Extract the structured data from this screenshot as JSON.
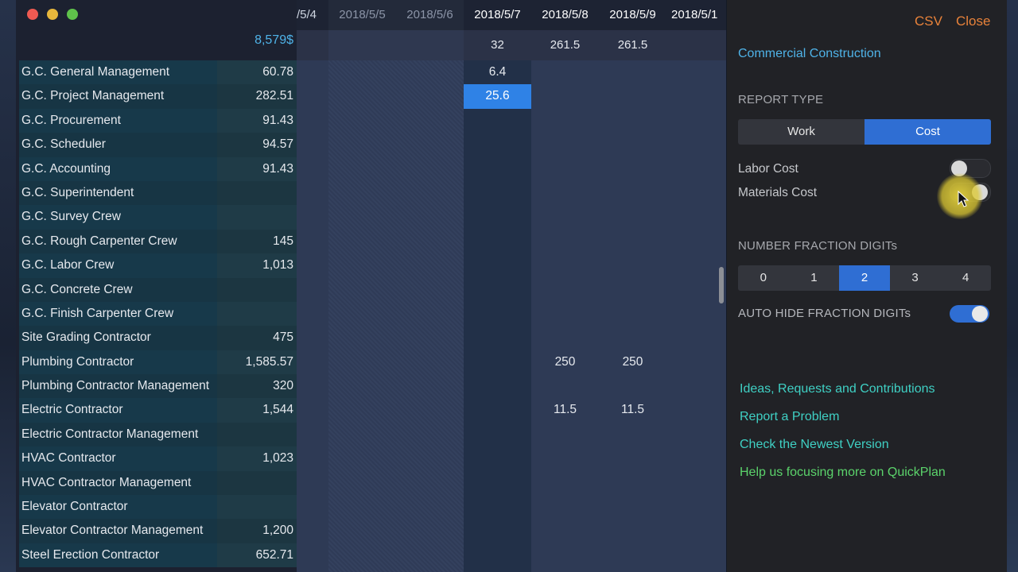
{
  "window": {
    "total": "8,579$"
  },
  "dates": [
    {
      "label": "/5/4",
      "kind": "weekday",
      "sum": "",
      "values": {}
    },
    {
      "label": "2018/5/5",
      "kind": "weekend",
      "sum": "",
      "values": {}
    },
    {
      "label": "2018/5/6",
      "kind": "weekend",
      "sum": "",
      "values": {}
    },
    {
      "label": "2018/5/7",
      "kind": "today",
      "sum": "32",
      "values": {
        "0": "6.4",
        "1": "25.6"
      }
    },
    {
      "label": "2018/5/8",
      "kind": "weekday",
      "sum": "261.5",
      "values": {
        "12": "250",
        "14": "11.5"
      }
    },
    {
      "label": "2018/5/9",
      "kind": "weekday",
      "sum": "261.5",
      "values": {
        "12": "250",
        "14": "11.5"
      }
    },
    {
      "label": "2018/5/1",
      "kind": "weekday",
      "sum": "",
      "values": {}
    }
  ],
  "rows": [
    {
      "name": "G.C. General Management",
      "total": "60.78"
    },
    {
      "name": "G.C. Project Management",
      "total": "282.51"
    },
    {
      "name": "G.C. Procurement",
      "total": "91.43"
    },
    {
      "name": "G.C. Scheduler",
      "total": "94.57"
    },
    {
      "name": "G.C. Accounting",
      "total": "91.43"
    },
    {
      "name": "G.C. Superintendent",
      "total": ""
    },
    {
      "name": "G.C. Survey Crew",
      "total": ""
    },
    {
      "name": "G.C. Rough Carpenter Crew",
      "total": "145"
    },
    {
      "name": "G.C. Labor Crew",
      "total": "1,013"
    },
    {
      "name": "G.C. Concrete Crew",
      "total": ""
    },
    {
      "name": "G.C. Finish Carpenter Crew",
      "total": ""
    },
    {
      "name": "Site Grading Contractor",
      "total": "475"
    },
    {
      "name": "Plumbing Contractor",
      "total": "1,585.57"
    },
    {
      "name": "Plumbing Contractor Management",
      "total": "320"
    },
    {
      "name": "Electric Contractor",
      "total": "1,544"
    },
    {
      "name": "Electric Contractor Management",
      "total": ""
    },
    {
      "name": "HVAC Contractor",
      "total": "1,023"
    },
    {
      "name": "HVAC Contractor Management",
      "total": ""
    },
    {
      "name": "Elevator Contractor",
      "total": ""
    },
    {
      "name": "Elevator Contractor Management",
      "total": "1,200"
    },
    {
      "name": "Steel Erection Contractor",
      "total": "652.71"
    }
  ],
  "panel": {
    "csv_label": "CSV",
    "close_label": "Close",
    "project_title": "Commercial Construction",
    "report_type_label": "REPORT TYPE",
    "report_type_options": [
      "Work",
      "Cost"
    ],
    "report_type_selected": "Cost",
    "labor_cost_label": "Labor Cost",
    "materials_cost_label": "Materials Cost",
    "fraction_label": "NUMBER FRACTION DIGITs",
    "fraction_options": [
      "0",
      "1",
      "2",
      "3",
      "4"
    ],
    "fraction_selected": "2",
    "auto_hide_label": "AUTO HIDE FRACTION DIGITs",
    "links": {
      "ideas": "Ideas, Requests and Contributions",
      "report": "Report a Problem",
      "newest": "Check the Newest Version",
      "help": "Help us focusing more on QuickPlan"
    },
    "colors": {
      "accent": "#2f6ed3",
      "link": "#3fd0c4",
      "help_link": "#5bd36b",
      "header_button": "#e8823a"
    }
  }
}
